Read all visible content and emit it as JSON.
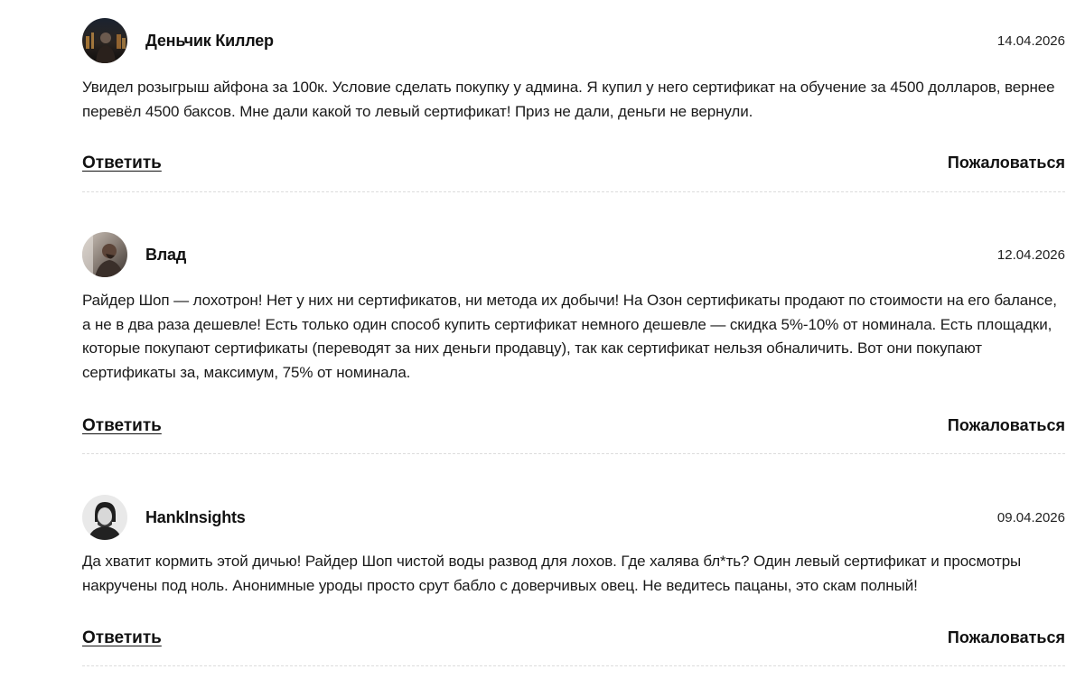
{
  "comments": [
    {
      "author": "Деньчик Киллер",
      "date": "14.04.2026",
      "avatar_icon": "avatar-photo-city-night",
      "text": "Увидел розыгрыш айфона за 100к. Условие сделать покупку у админа. Я купил у него сертификат на обучение за 4500 долларов, вернее перевёл 4500 баксов. Мне дали какой то левый сертификат! Приз не дали, деньги не вернули.",
      "reply_label": "Ответить",
      "report_label": "Пожаловаться"
    },
    {
      "author": "Влад",
      "date": "12.04.2026",
      "avatar_icon": "avatar-photo-man-profile",
      "text": "Райдер Шоп — лохотрон! Нет у них ни сертификатов, ни метода их добычи! На Озон сертификаты продают по стоимости на его балансе, а не в два раза дешевле! Есть только один способ купить сертификат немного дешевле — скидка 5%-10% от номинала. Есть площадки, которые покупают сертификаты (переводят за них деньги продавцу), так как сертификат нельзя обналичить. Вот они покупают сертификаты за, максимум, 75% от номинала.",
      "reply_label": "Ответить",
      "report_label": "Пожаловаться"
    },
    {
      "author": "HankInsights",
      "date": "09.04.2026",
      "avatar_icon": "avatar-photo-bw-portrait",
      "text": "Да хватит кормить этой дичью! Райдер Шоп чистой воды развод для лохов. Где халява бл*ть? Один левый сертификат и просмотры накручены под ноль. Анонимные уроды просто срут бабло с доверчивых овец. Не ведитесь пацаны, это скам полный!",
      "reply_label": "Ответить",
      "report_label": "Пожаловаться"
    }
  ]
}
